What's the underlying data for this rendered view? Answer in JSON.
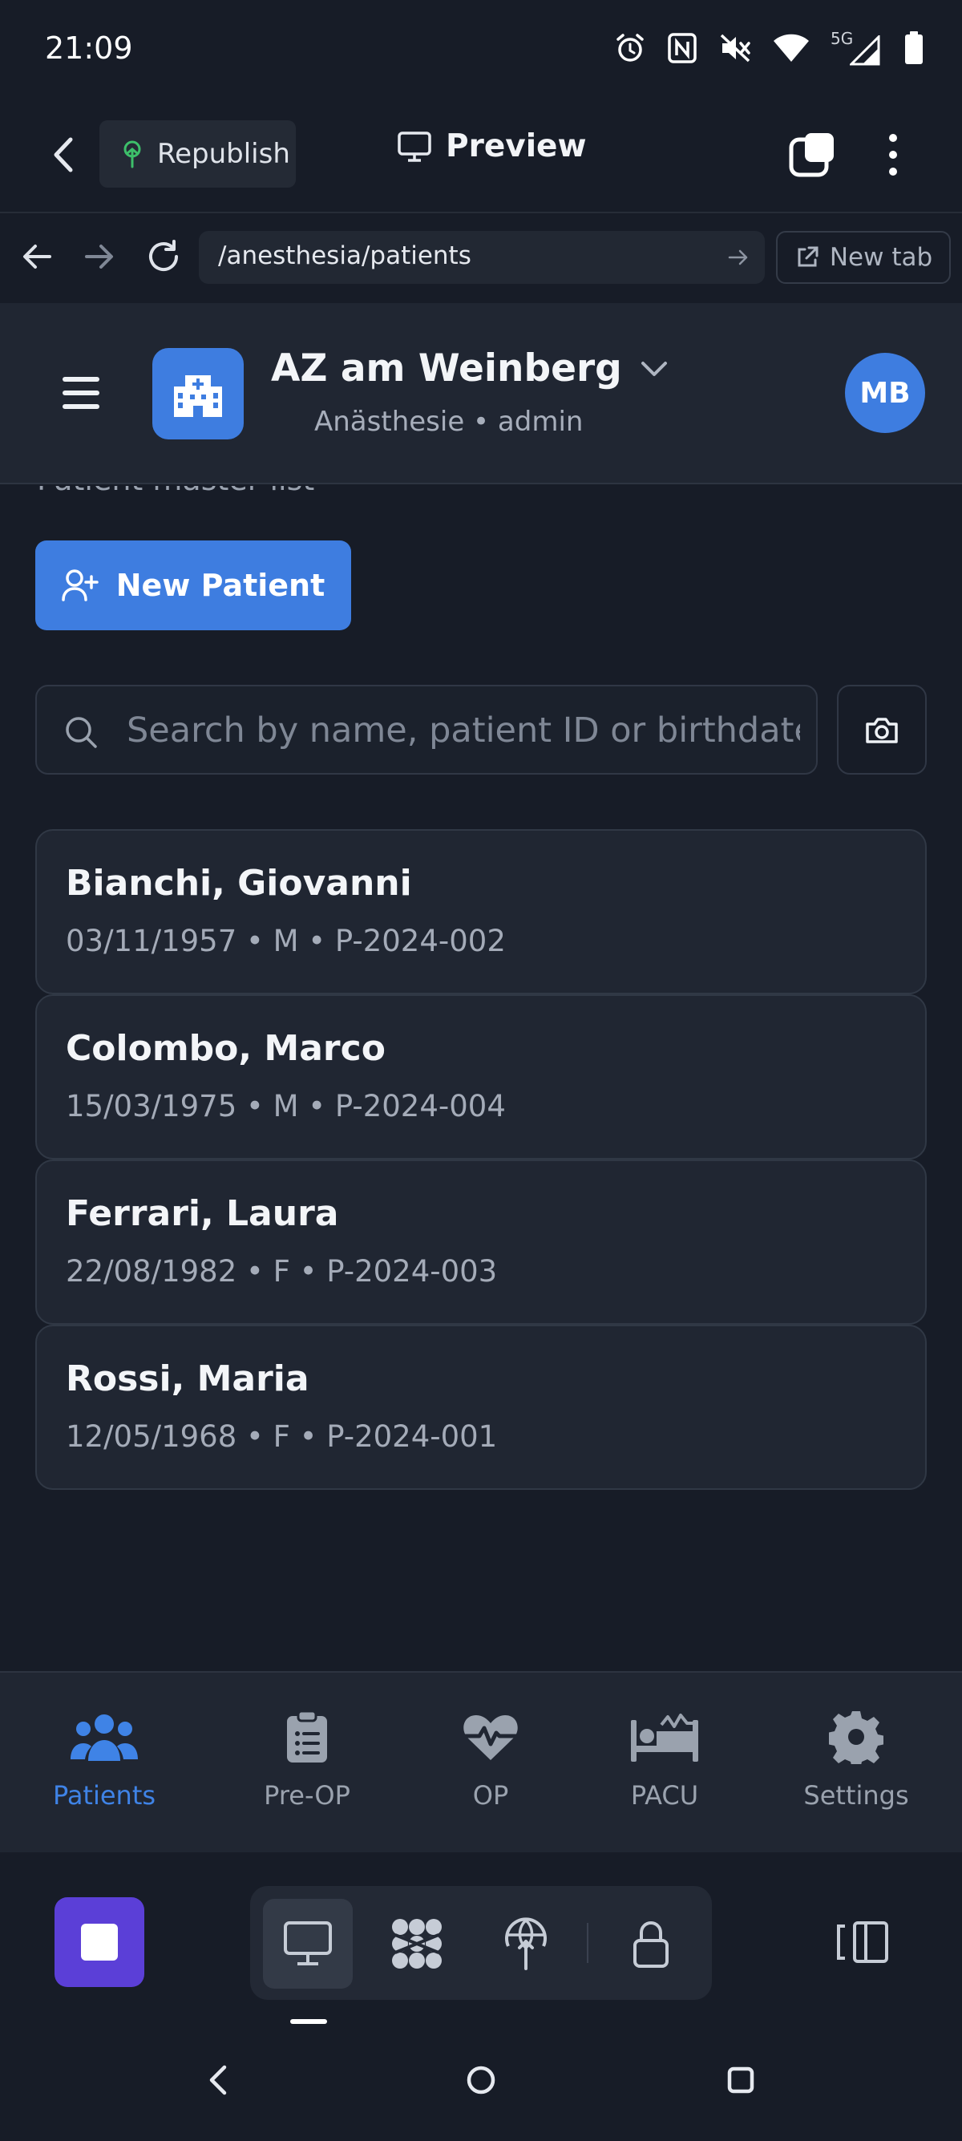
{
  "status_bar": {
    "time": "21:09",
    "icons": [
      "alarm-icon",
      "nfc-icon",
      "mute-icon",
      "wifi-icon",
      "5g-icon",
      "signal-icon",
      "battery-icon"
    ],
    "network": "5G"
  },
  "preview_toolbar": {
    "republish_label": "Republish",
    "preview_label": "Preview"
  },
  "browser": {
    "url": "/anesthesia/patients",
    "new_tab_label": "New tab"
  },
  "app_header": {
    "hospital_name": "AZ am Weinberg",
    "subtitle": "Anästhesie • admin",
    "avatar_initials": "MB"
  },
  "page": {
    "subtitle": "Patient master list",
    "new_patient_label": "New Patient",
    "search_placeholder": "Search by name, patient ID or birthdate"
  },
  "patients": [
    {
      "name": "Bianchi, Giovanni",
      "meta": "03/11/1957 • M • P-2024-002"
    },
    {
      "name": "Colombo, Marco",
      "meta": "15/03/1975 • M • P-2024-004"
    },
    {
      "name": "Ferrari, Laura",
      "meta": "22/08/1982 • F • P-2024-003"
    },
    {
      "name": "Rossi, Maria",
      "meta": "12/05/1968 • F • P-2024-001"
    }
  ],
  "bottom_nav": {
    "active": "Patients",
    "items": [
      {
        "label": "Patients",
        "icon": "users-icon"
      },
      {
        "label": "Pre-OP",
        "icon": "clipboard-icon"
      },
      {
        "label": "OP",
        "icon": "heartbeat-icon"
      },
      {
        "label": "PACU",
        "icon": "bed-icon"
      },
      {
        "label": "Settings",
        "icon": "gear-icon"
      }
    ]
  },
  "colors": {
    "background": "#171c27",
    "surface": "#202632",
    "accent": "#3e7de0",
    "stop_button": "#5b3fd7"
  }
}
